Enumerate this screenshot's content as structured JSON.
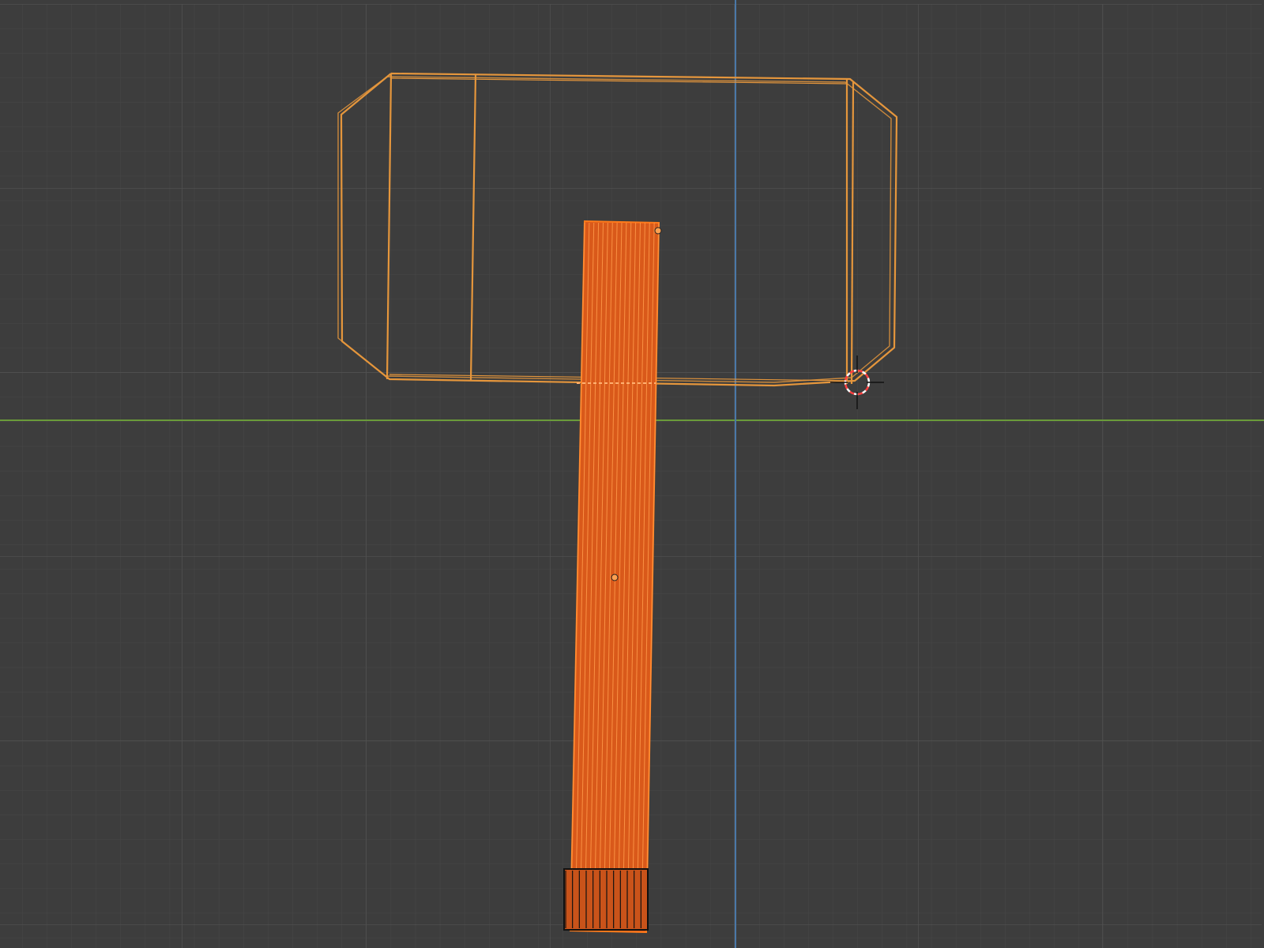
{
  "viewport": {
    "view": "wireframe",
    "background_color": "#3d3d3d",
    "grid_minor_color": "#474747",
    "grid_major_color": "#525252",
    "x_axis_color": "#6a9a3a",
    "y_axis_color": "#4a78a8"
  },
  "objects": {
    "hammer_head": {
      "name": "hammer-head",
      "selected": true,
      "active": false,
      "wire_color": "#e5963c"
    },
    "hammer_handle": {
      "name": "hammer-handle",
      "selected": true,
      "active": true,
      "wire_color": "#ff7a1a",
      "fill_color": "#d9591a"
    },
    "handle_cap": {
      "name": "handle-cap",
      "selected": false,
      "wire_color": "#111111"
    }
  },
  "cursor": {
    "name": "3d-cursor",
    "ring_colors": [
      "#ff4040",
      "#ffffff"
    ]
  }
}
